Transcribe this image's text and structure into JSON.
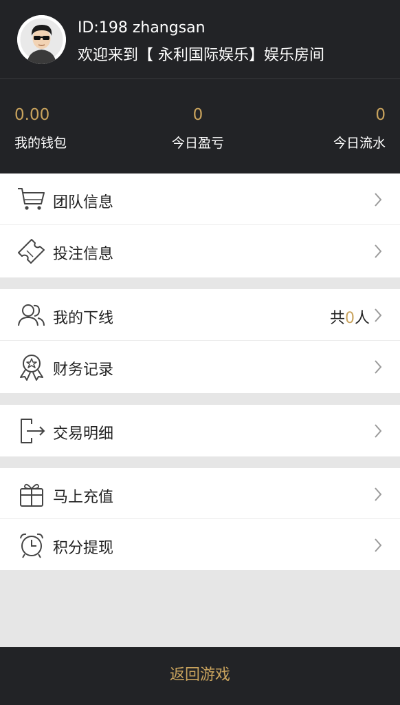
{
  "user": {
    "id_line": "ID:198 zhangsan",
    "welcome": "欢迎来到【 永利国际娱乐】娱乐房间"
  },
  "stats": [
    {
      "value": "0.00",
      "label": "我的钱包"
    },
    {
      "value": "0",
      "label": "今日盈亏"
    },
    {
      "value": "0",
      "label": "今日流水"
    }
  ],
  "menu": {
    "team_info": "团队信息",
    "bet_info": "投注信息",
    "my_downline": "我的下线",
    "downline_prefix": "共",
    "downline_count": "0",
    "downline_suffix": "人",
    "finance_records": "财务记录",
    "transaction_details": "交易明细",
    "recharge": "马上充值",
    "points_withdraw": "积分提现"
  },
  "footer": {
    "back_label": "返回游戏"
  },
  "colors": {
    "accent": "#c9a35d",
    "header_bg": "#222326",
    "page_bg": "#e6e6e6"
  },
  "icons": [
    "avatar",
    "cart-icon",
    "ticket-icon",
    "users-icon",
    "badge-icon",
    "exit-icon",
    "gift-icon",
    "alarm-clock-icon",
    "chevron-right-icon"
  ]
}
